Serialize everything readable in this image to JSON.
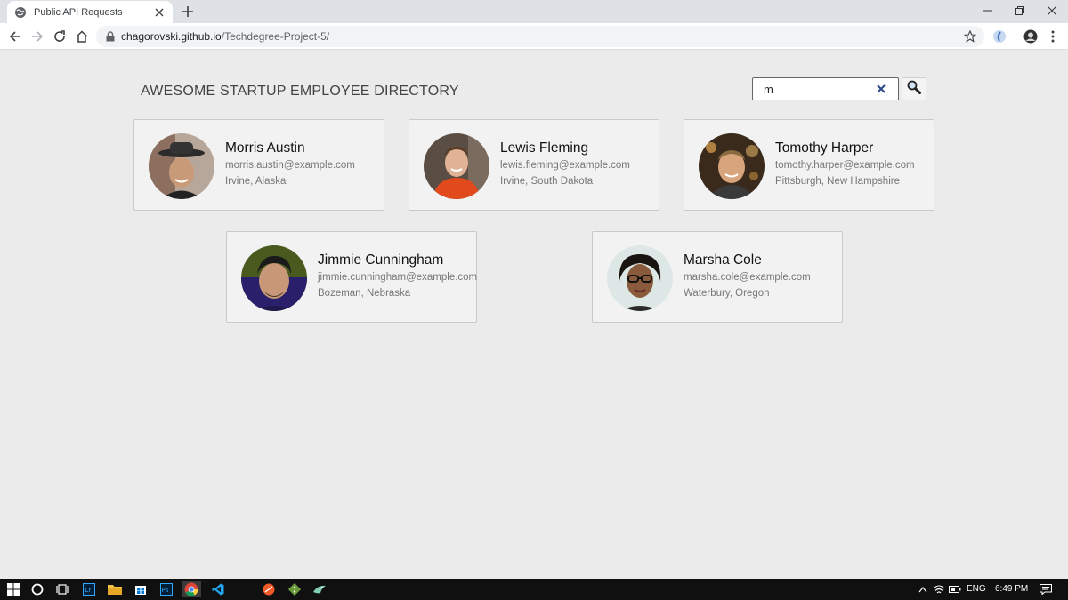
{
  "browser": {
    "tab_title": "Public API Requests",
    "url_host": "chagorovski.github.io",
    "url_path": "/Techdegree-Project-5/"
  },
  "page": {
    "title": "AWESOME STARTUP EMPLOYEE DIRECTORY",
    "search": {
      "value": "m",
      "placeholder": ""
    }
  },
  "employees": [
    {
      "name": "Morris Austin",
      "email": "morris.austin@example.com",
      "location": "Irvine, Alaska"
    },
    {
      "name": "Lewis Fleming",
      "email": "lewis.fleming@example.com",
      "location": "Irvine, South Dakota"
    },
    {
      "name": "Tomothy Harper",
      "email": "tomothy.harper@example.com",
      "location": "Pittsburgh, New Hampshire"
    },
    {
      "name": "Jimmie Cunningham",
      "email": "jimmie.cunningham@example.com",
      "location": "Bozeman, Nebraska"
    },
    {
      "name": "Marsha Cole",
      "email": "marsha.cole@example.com",
      "location": "Waterbury, Oregon"
    }
  ],
  "taskbar": {
    "language": "ENG",
    "time": "6:49 PM"
  },
  "colors": {
    "page_bg": "#ebebeb",
    "card_bg": "#f2f2f2",
    "clear_icon": "#2a4a8a",
    "taskbar_bg": "#101010"
  }
}
